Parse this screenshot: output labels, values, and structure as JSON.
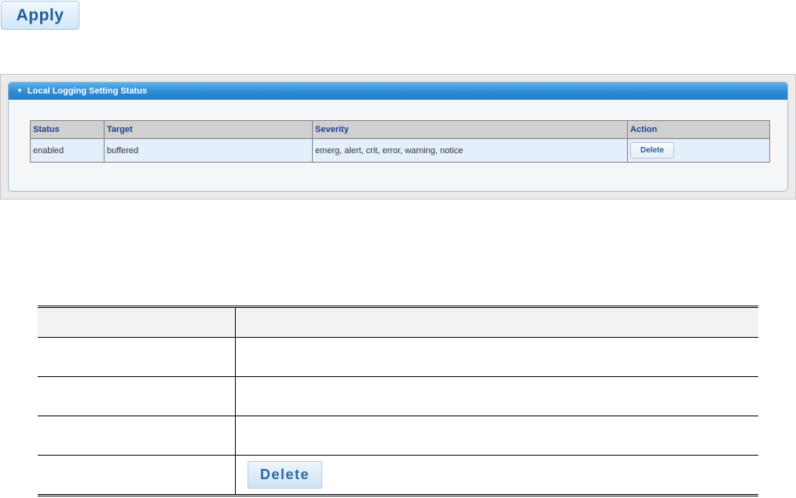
{
  "apply_button": {
    "label": "Apply"
  },
  "panel": {
    "title": "Local Logging Setting Status",
    "table": {
      "headers": [
        "Status",
        "Target",
        "Severity",
        "Action"
      ],
      "rows": [
        {
          "status": "enabled",
          "target": "buffered",
          "severity": "emerg, alert, crit, error, warning, notice",
          "action_label": "Delete"
        }
      ]
    }
  },
  "description_table": {
    "headers": [
      "",
      ""
    ],
    "rows": [
      {
        "object": "",
        "description": ""
      },
      {
        "object": "",
        "description": ""
      },
      {
        "object": "",
        "description": ""
      },
      {
        "object": "",
        "button_label": "Delete"
      }
    ]
  },
  "colors": {
    "panel_header": "#2f8ad3",
    "table_header_text": "#1f3f8f",
    "row_background": "#e4effb",
    "button_text": "#1f5f9a"
  }
}
